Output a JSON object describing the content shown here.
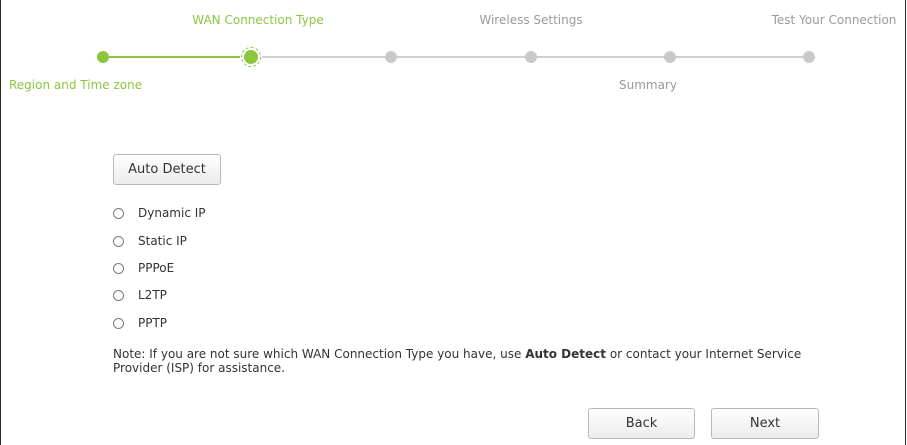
{
  "wizard": {
    "steps": [
      {
        "label": "Region and Time zone",
        "status": "done"
      },
      {
        "label": "WAN Connection Type",
        "status": "current"
      },
      {
        "label": "Wireless Settings",
        "status": "pending"
      },
      {
        "label": "Summary",
        "status": "pending"
      },
      {
        "label": "Test Your Connection",
        "status": "pending"
      }
    ],
    "accent_color": "#8cc63f",
    "pending_color": "#c9c9c9"
  },
  "form": {
    "auto_detect_label": "Auto Detect",
    "options": [
      {
        "label": "Dynamic IP",
        "selected": false
      },
      {
        "label": "Static IP",
        "selected": false
      },
      {
        "label": "PPPoE",
        "selected": false
      },
      {
        "label": "L2TP",
        "selected": false
      },
      {
        "label": "PPTP",
        "selected": false
      }
    ],
    "note_prefix": "Note: If you are not sure which WAN Connection Type you have, use ",
    "note_bold": "Auto Detect",
    "note_suffix": " or contact your Internet Service Provider (ISP) for assistance."
  },
  "footer": {
    "back_label": "Back",
    "next_label": "Next"
  }
}
